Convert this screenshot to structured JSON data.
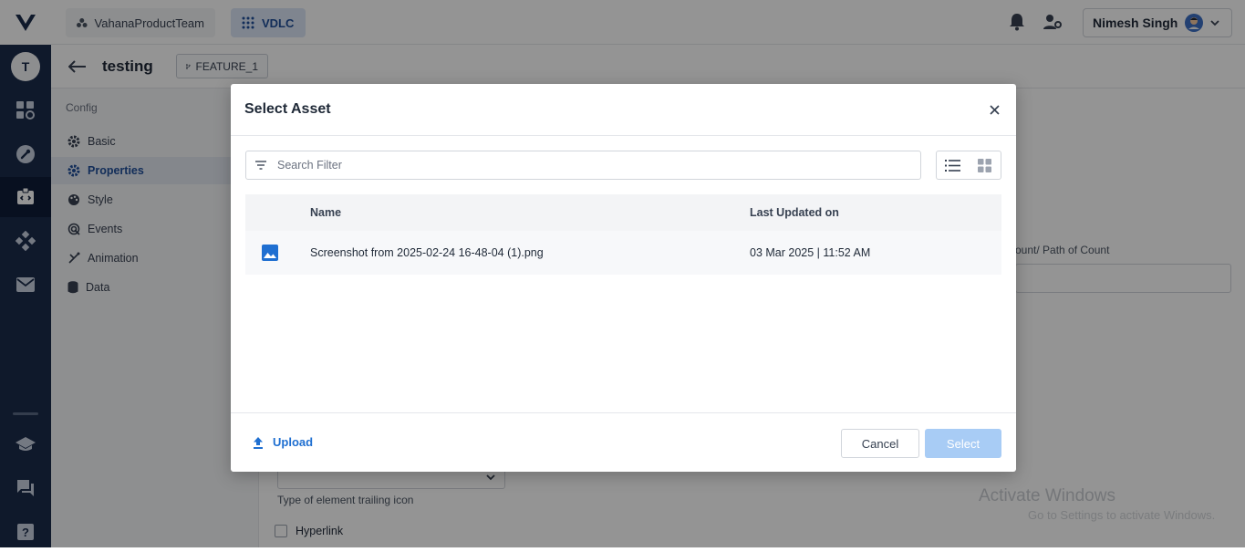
{
  "rail": {
    "avatar_initial": "T"
  },
  "topbar": {
    "team_name": "VahanaProductTeam",
    "project_name": "VDLC",
    "user_name": "Nimesh Singh"
  },
  "subheader": {
    "title": "testing",
    "branch": "FEATURE_1"
  },
  "config": {
    "heading": "Config",
    "items": [
      {
        "label": "Basic",
        "icon": "gear-icon"
      },
      {
        "label": "Properties",
        "icon": "gear-icon",
        "active": true
      },
      {
        "label": "Style",
        "icon": "palette-icon"
      },
      {
        "label": "Events",
        "icon": "events-icon"
      },
      {
        "label": "Animation",
        "icon": "animation-icon"
      },
      {
        "label": "Data",
        "icon": "database-icon"
      }
    ]
  },
  "background": {
    "count_label": "ount/ Path of Count",
    "trailing_icon_label": "Type of element trailing icon",
    "hyperlink_label": "Hyperlink",
    "watermark_title": "Activate Windows",
    "watermark_sub": "Go to Settings to activate Windows."
  },
  "modal": {
    "title": "Select Asset",
    "search_placeholder": "Search Filter",
    "columns": {
      "name": "Name",
      "updated": "Last Updated on"
    },
    "rows": [
      {
        "name": "Screenshot from 2025-02-24 16-48-04 (1).png",
        "updated": "03 Mar 2025 | 11:52 AM",
        "icon": "image-icon"
      }
    ],
    "upload_label": "Upload",
    "cancel_label": "Cancel",
    "select_label": "Select"
  },
  "colors": {
    "rail": "#1b2b4b",
    "accent": "#1f6fd1",
    "select_disabled": "#a8ccf5"
  }
}
